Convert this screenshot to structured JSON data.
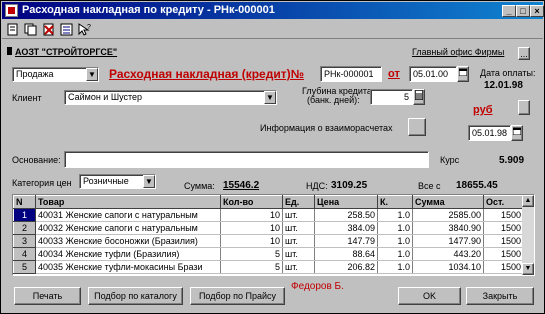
{
  "window": {
    "title": "Расходная накладная по кредиту - РНк-000001",
    "minimize": "_",
    "maximize": "□",
    "close": "×"
  },
  "toolbar": {
    "icons": [
      "new-doc-icon",
      "copy-icon",
      "delete-icon",
      "list-icon",
      "help-icon"
    ]
  },
  "header": {
    "firm": "АОЗТ \"СТРОЙТОРГСЕ\"",
    "main_firm_label": "Главный офис Фирмы",
    "main_firm_btn": "...",
    "doc_kind": "Продажа",
    "doc_title": "Расходная накладная (кредит)№",
    "doc_number": "РНк-000001",
    "from_label": "от",
    "doc_date": "05.01.00",
    "pay_date_label": "Дата оплаты:",
    "pay_date": "12.01.98"
  },
  "client": {
    "label": "Клиент",
    "value": "Саймон и Шустер",
    "depth_label_1": "Глубина кредита",
    "depth_label_2": "(банк. дней):",
    "depth_value": "5",
    "currency": "руб",
    "info_label": "Информация о взаиморасчетах",
    "rate_date": "05.01.98",
    "rate_label": "Курс",
    "rate_value": "5.909"
  },
  "basis": {
    "label": "Основание:",
    "value": ""
  },
  "summary": {
    "category_label": "Категория цен",
    "category_value": "Розничные",
    "sum_label": "Сумма:",
    "sum_value": "15546.2",
    "vat_label": "НДС:",
    "vat_value": "3109.25",
    "total_label": "Все с",
    "total_value": "18655.45"
  },
  "table": {
    "columns": [
      "N",
      "Товар",
      "Кол-во",
      "Ед.",
      "Цена",
      "К.",
      "Сумма",
      "Ост."
    ],
    "rows": [
      {
        "n": "1",
        "item": "40031 Женские сапоги с натуральным",
        "qty": "10",
        "unit": "шт.",
        "price": "258.50",
        "k": "1.0",
        "sum": "2585.00",
        "rest": "1500"
      },
      {
        "n": "2",
        "item": "40032 Женские сапоги с натуральным",
        "qty": "10",
        "unit": "шт.",
        "price": "384.09",
        "k": "1.0",
        "sum": "3840.90",
        "rest": "1500"
      },
      {
        "n": "3",
        "item": "40033 Женские босоножки (Бразилия)",
        "qty": "10",
        "unit": "шт.",
        "price": "147.79",
        "k": "1.0",
        "sum": "1477.90",
        "rest": "1500"
      },
      {
        "n": "4",
        "item": "40034 Женские туфли (Бразилия)",
        "qty": "5",
        "unit": "шт.",
        "price": "88.64",
        "k": "1.0",
        "sum": "443.20",
        "rest": "1500"
      },
      {
        "n": "5",
        "item": "40035 Женские туфли-мокасины Брази",
        "qty": "5",
        "unit": "шт.",
        "price": "206.82",
        "k": "1.0",
        "sum": "1034.10",
        "rest": "1500"
      }
    ]
  },
  "footer": {
    "print": "Печать",
    "catalog": "Подбор по каталогу",
    "pricelist": "Подбор по Прайсу",
    "author": "Федоров Б.",
    "ok": "OK",
    "close": "Закрыть"
  },
  "colors": {
    "accent_red": "#c00000",
    "title_blue": "#000080"
  }
}
